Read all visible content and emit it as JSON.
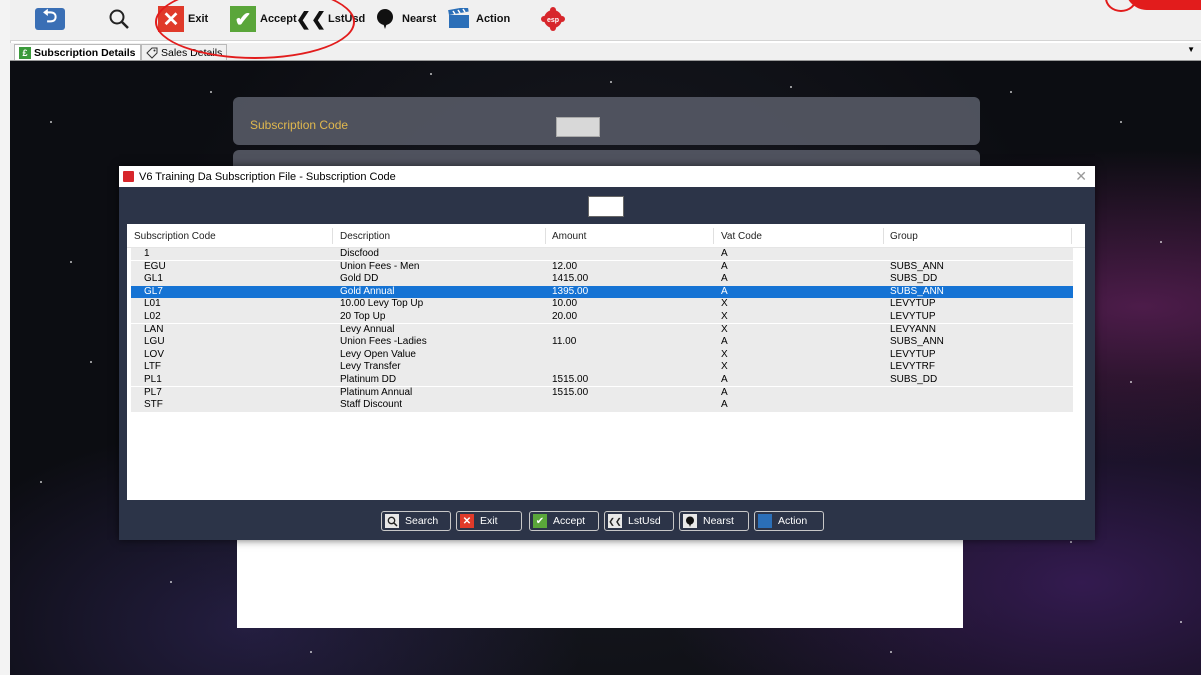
{
  "toolbar": {
    "exit_label": "Exit",
    "accept_label": "Accept",
    "lastused_label": "LstUsd",
    "nearest_label": "Nearst",
    "action_label": "Action",
    "esp_label": "esp"
  },
  "tabs": [
    {
      "label": "Subscription Details",
      "active": true,
      "icon": "pound-icon"
    },
    {
      "label": "Sales Details",
      "active": false,
      "icon": "tag-icon"
    }
  ],
  "form": {
    "subscription_code_label": "Subscription Code"
  },
  "dialog": {
    "title": "V6 Training Da Subscription File - Subscription Code",
    "columns": [
      "Subscription Code",
      "Description",
      "Amount",
      "Vat Code",
      "Group"
    ],
    "rows": [
      {
        "code": "1",
        "description": "Discfood",
        "amount": "",
        "vat": "A",
        "group": ""
      },
      {
        "code": "EGU",
        "description": "Union Fees - Men",
        "amount": "12.00",
        "vat": "A",
        "group": "SUBS_ANN"
      },
      {
        "code": "GL1",
        "description": "Gold DD",
        "amount": "1415.00",
        "vat": "A",
        "group": "SUBS_DD"
      },
      {
        "code": "GL7",
        "description": "Gold Annual",
        "amount": "1395.00",
        "vat": "A",
        "group": "SUBS_ANN",
        "selected": true
      },
      {
        "code": "L01",
        "description": "10.00 Levy Top Up",
        "amount": "10.00",
        "vat": "X",
        "group": "LEVYTUP"
      },
      {
        "code": "L02",
        "description": "20 Top Up",
        "amount": "20.00",
        "vat": "X",
        "group": "LEVYTUP"
      },
      {
        "code": "LAN",
        "description": "Levy Annual",
        "amount": "",
        "vat": "X",
        "group": "LEVYANN"
      },
      {
        "code": "LGU",
        "description": "Union Fees -Ladies",
        "amount": "11.00",
        "vat": "A",
        "group": "SUBS_ANN"
      },
      {
        "code": "LOV",
        "description": "Levy Open Value",
        "amount": "",
        "vat": "X",
        "group": "LEVYTUP"
      },
      {
        "code": "LTF",
        "description": "Levy Transfer",
        "amount": "",
        "vat": "X",
        "group": "LEVYTRF"
      },
      {
        "code": "PL1",
        "description": "Platinum DD",
        "amount": "1515.00",
        "vat": "A",
        "group": "SUBS_DD"
      },
      {
        "code": "PL7",
        "description": "Platinum Annual",
        "amount": "1515.00",
        "vat": "A",
        "group": ""
      },
      {
        "code": "STF",
        "description": "Staff Discount",
        "amount": "",
        "vat": "A",
        "group": ""
      }
    ],
    "buttons": {
      "search": "Search",
      "exit": "Exit",
      "accept": "Accept",
      "lastused": "LstUsd",
      "nearest": "Nearst",
      "action": "Action"
    }
  },
  "colors": {
    "accent_selection": "#1573d4",
    "dialog_bg": "#2c3448",
    "label_gold": "#e0b84e",
    "annotation_red": "#e21c1c"
  }
}
